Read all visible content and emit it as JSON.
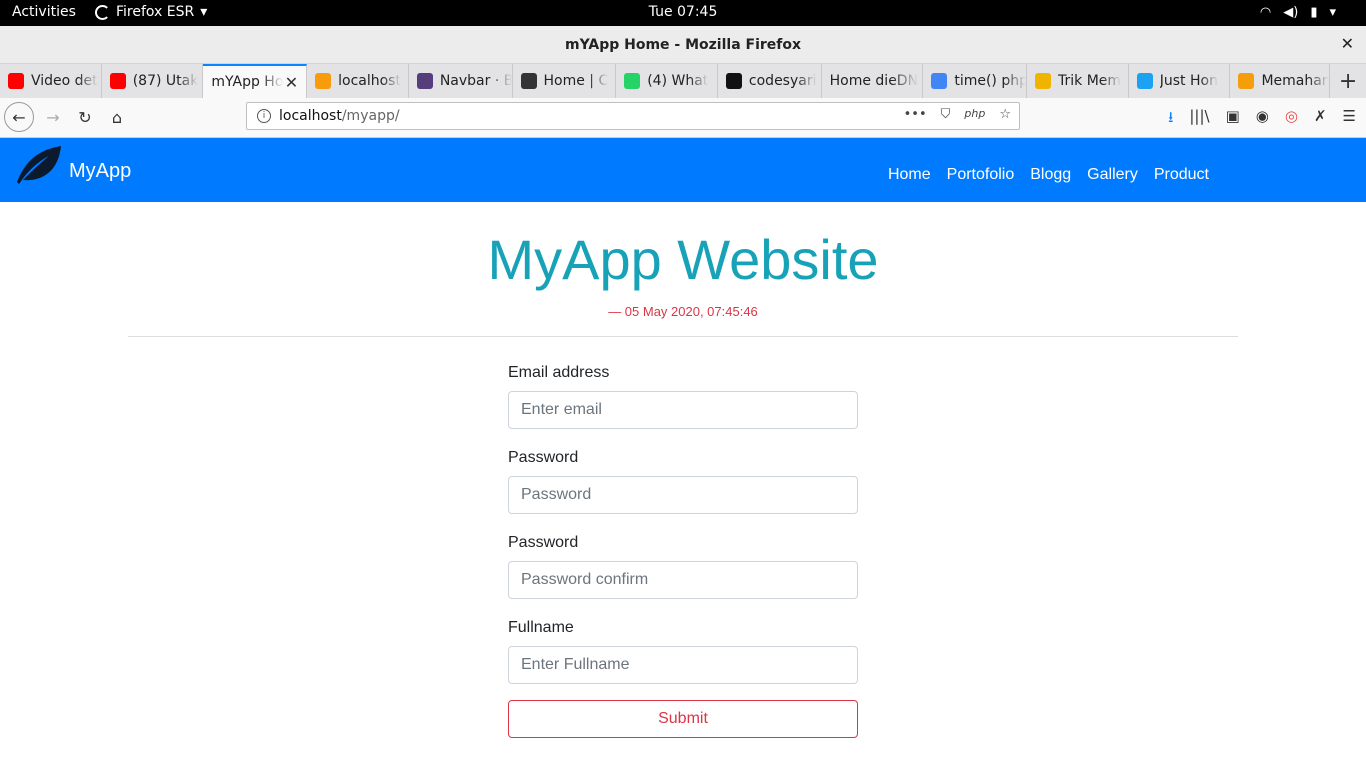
{
  "system": {
    "activities": "Activities",
    "app_menu": "Firefox ESR",
    "clock": "Tue 07:45"
  },
  "window": {
    "title": "mYApp Home - Mozilla Firefox",
    "close": "✕"
  },
  "tabs": [
    {
      "label": "Video det",
      "icon": "youtube-icon",
      "color": "#ff0000"
    },
    {
      "label": "(87) Utak",
      "icon": "youtube-icon",
      "color": "#ff0000"
    },
    {
      "label": "mYApp Ho",
      "icon": "none",
      "active": true
    },
    {
      "label": "localhost",
      "icon": "phpmyadmin-icon",
      "color": "#f89c0e"
    },
    {
      "label": "Navbar · B",
      "icon": "bootstrap-icon",
      "color": "#563d7c"
    },
    {
      "label": "Home | C",
      "icon": "avatar-icon",
      "color": "#333333"
    },
    {
      "label": "(4) What",
      "icon": "whatsapp-icon",
      "color": "#25d366"
    },
    {
      "label": "codesyari",
      "icon": "github-icon",
      "color": "#111111"
    },
    {
      "label": "Home dieDN",
      "icon": "none"
    },
    {
      "label": "time() php",
      "icon": "google-icon",
      "color": "#4285f4"
    },
    {
      "label": "Trik Mem",
      "icon": "linux-icon",
      "color": "#f0b400"
    },
    {
      "label": "Just Hon",
      "icon": "twitter-icon",
      "color": "#1da1f2"
    },
    {
      "label": "Memahan",
      "icon": "orange-icon",
      "color": "#f59e0b"
    }
  ],
  "url": {
    "host": "localhost",
    "path": "/myapp/"
  },
  "app": {
    "brand": "MyApp",
    "nav": [
      "Home",
      "Portofolio",
      "Blogg",
      "Gallery",
      "Product"
    ],
    "heading": "MyApp Website",
    "date": "— 05 May 2020, 07:45:46",
    "form": {
      "email_label": "Email address",
      "email_placeholder": "Enter email",
      "password_label": "Password",
      "password_placeholder": "Password",
      "password_confirm_label": "Password",
      "password_confirm_placeholder": "Password confirm",
      "fullname_label": "Fullname",
      "fullname_placeholder": "Enter Fullname",
      "submit": "Submit"
    }
  },
  "colors": {
    "navbar": "#007bff",
    "heading": "#17a2b8",
    "date": "#dc3545",
    "submit": "#dc3545"
  }
}
